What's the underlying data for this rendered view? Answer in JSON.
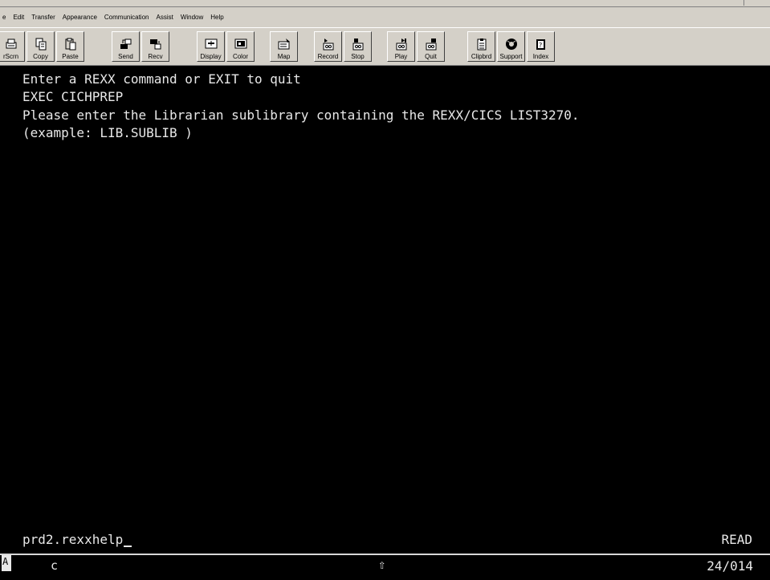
{
  "menubar": {
    "items": [
      "e",
      "Edit",
      "Transfer",
      "Appearance",
      "Communication",
      "Assist",
      "Window",
      "Help"
    ]
  },
  "toolbar": {
    "buttons": [
      {
        "label": "rScrn",
        "icon": "print-screen-icon"
      },
      {
        "label": "Copy",
        "icon": "copy-icon"
      },
      {
        "label": "Paste",
        "icon": "paste-icon"
      },
      {
        "label": "Send",
        "icon": "send-icon"
      },
      {
        "label": "Recv",
        "icon": "receive-icon"
      },
      {
        "label": "Display",
        "icon": "display-icon"
      },
      {
        "label": "Color",
        "icon": "color-icon"
      },
      {
        "label": "Map",
        "icon": "map-icon"
      },
      {
        "label": "Record",
        "icon": "record-icon"
      },
      {
        "label": "Stop",
        "icon": "stop-icon"
      },
      {
        "label": "Play",
        "icon": "play-icon"
      },
      {
        "label": "Quit",
        "icon": "quit-icon"
      },
      {
        "label": "Clipbrd",
        "icon": "clipboard-icon"
      },
      {
        "label": "Support",
        "icon": "support-icon"
      },
      {
        "label": "Index",
        "icon": "index-icon"
      }
    ]
  },
  "terminal": {
    "lines": [
      "Enter a REXX command or EXIT to quit",
      "EXEC CICHPREP",
      "Please enter the Librarian sublibrary containing the REXX/CICS LIST3270.",
      "(example: LIB.SUBLIB )"
    ],
    "command_input": "prd2.rexxhelp",
    "status": "READ"
  },
  "oia": {
    "indicator": "A",
    "mode": "c",
    "shift_symbol": "⇧",
    "cursor_position": "24/014"
  }
}
